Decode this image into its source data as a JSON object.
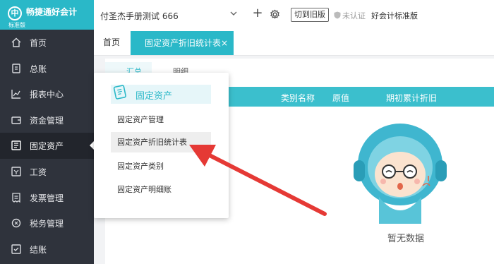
{
  "app": {
    "name": "畅捷通好会计",
    "edition": "标准版",
    "logo_glyph": "中"
  },
  "sidebar": {
    "items": [
      {
        "label": "首页",
        "icon": "home-icon"
      },
      {
        "label": "总账",
        "icon": "ledger-icon"
      },
      {
        "label": "报表中心",
        "icon": "report-chart-icon"
      },
      {
        "label": "资金管理",
        "icon": "wallet-icon"
      },
      {
        "label": "固定资产",
        "icon": "asset-icon",
        "active": true
      },
      {
        "label": "工资",
        "icon": "salary-icon"
      },
      {
        "label": "发票管理",
        "icon": "invoice-icon"
      },
      {
        "label": "税务管理",
        "icon": "tax-icon"
      },
      {
        "label": "结账",
        "icon": "checkout-icon"
      }
    ]
  },
  "topbar": {
    "company": "付圣杰手册测试 666",
    "add_symbol": "+",
    "switch_old": "切到旧版",
    "verify_status": "未认证",
    "version_label": "好会计标准版"
  },
  "tabs": {
    "home": "首页",
    "active": "固定资产折旧统计表",
    "close_symbol": "×"
  },
  "subtabs": [
    "汇总",
    "明细"
  ],
  "table": {
    "headers": [
      "类别名称",
      "原值",
      "期初累计折旧"
    ]
  },
  "empty": {
    "text": "暂无数据"
  },
  "dropdown": {
    "header": "固定资产",
    "items": [
      "固定资产管理",
      "固定资产折旧统计表",
      "固定资产类别",
      "固定资产明细账"
    ],
    "highlighted": "固定资产折旧统计表"
  },
  "colors": {
    "accent": "#2ab8c8",
    "sidebar": "#2f333c",
    "arrow": "#e53935"
  }
}
